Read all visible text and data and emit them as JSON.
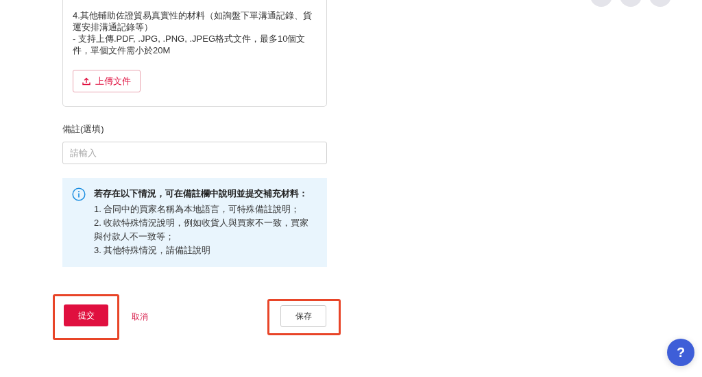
{
  "upload_card": {
    "lines": [
      "4.其他輔助佐證貿易真實性的材料（如詢盤下單溝通記錄、貨運安排溝通記錄等）",
      "- 支持上傳.PDF, .JPG, .PNG, .JPEG格式文件，最多10個文件，單個文件需小於20M"
    ],
    "upload_button": "上傳文件"
  },
  "remarks": {
    "label": "備註(選填)",
    "placeholder": "請輸入"
  },
  "notice": {
    "title": "若存在以下情況，可在備註欄中說明並提交補充材料：",
    "items": [
      "1. 合同中的買家名稱為本地語言，可特殊備註說明；",
      "2. 收款特殊情況說明，例如收貨人與買家不一致，買家與付款人不一致等；",
      "3. 其他特殊情況，請備註說明"
    ]
  },
  "actions": [
    {
      "label": "提交",
      "kind": "primary",
      "highlighted": true
    },
    {
      "label": "取消",
      "kind": "link",
      "highlighted": false
    },
    {
      "label": "保存",
      "kind": "outline",
      "highlighted": true
    }
  ],
  "help_button": "?"
}
